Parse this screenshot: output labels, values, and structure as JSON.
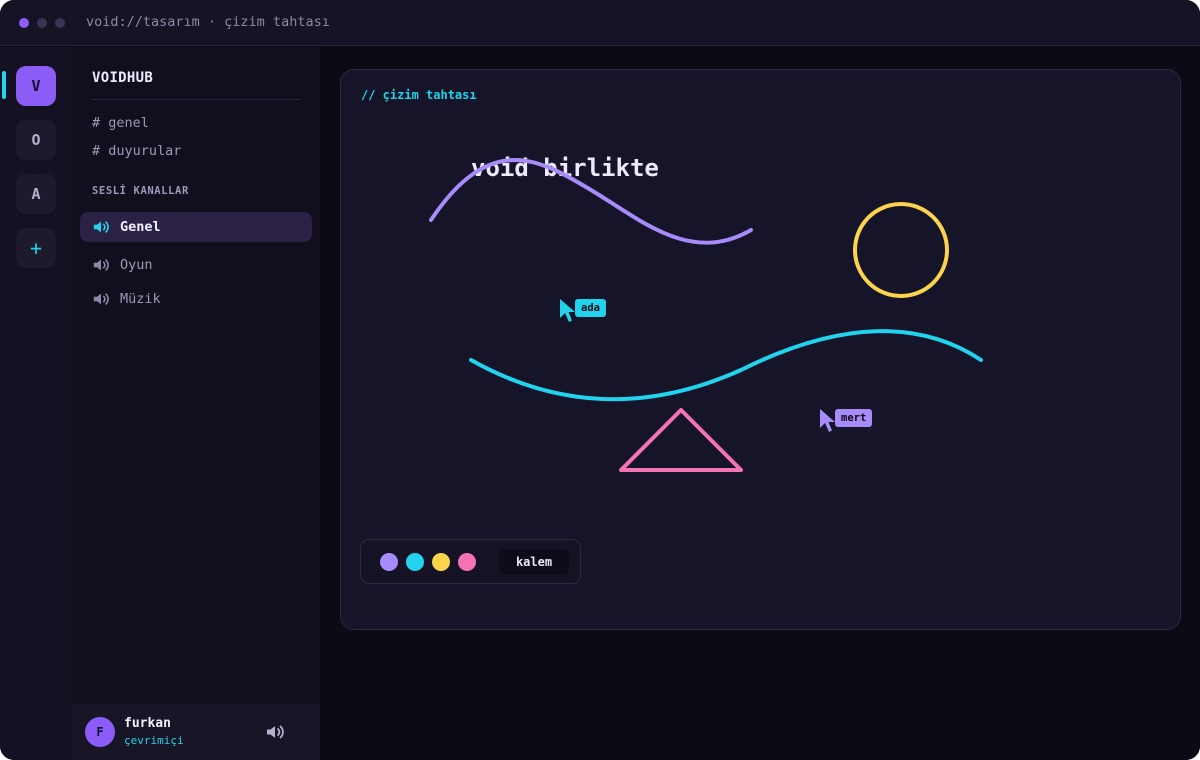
{
  "window": {
    "title": "void://tasarım · çizim tahtası"
  },
  "rail": {
    "servers": [
      {
        "letter": "V",
        "active": true
      },
      {
        "letter": "O",
        "active": false
      },
      {
        "letter": "A",
        "active": false
      }
    ],
    "add_label": "+"
  },
  "sidebar": {
    "server_name": "VOIDHUB",
    "text_channels": [
      "# genel",
      "# duyurular"
    ],
    "voice_section_label": "SESLİ KANALLAR",
    "voice_channels": [
      {
        "label": "Genel",
        "active": true,
        "icon": "speaker-icon"
      },
      {
        "label": "Oyun",
        "active": false,
        "icon": "speaker-icon"
      },
      {
        "label": "Müzik",
        "active": false,
        "icon": "speaker-icon"
      }
    ]
  },
  "user": {
    "initial": "F",
    "name": "furkan",
    "status": "çevrimiçi",
    "icon": "speaker-icon"
  },
  "board": {
    "heading": "// çizim tahtası",
    "canvas_text": "void birlikte",
    "cursors": [
      {
        "name": "ada",
        "color": "#22d3ee"
      },
      {
        "name": "mert",
        "color": "#a78bfa"
      }
    ],
    "palette": {
      "colors": [
        "#a78bfa",
        "#22d3ee",
        "#fcd34d",
        "#f472b6"
      ],
      "tool_label": "kalem"
    }
  },
  "colors": {
    "accent_violet": "#8b5cf6",
    "accent_cyan": "#22d3ee",
    "background": "#0c0a14",
    "stroke_violet": "#a78bfa",
    "stroke_cyan": "#22d3ee",
    "stroke_yellow": "#fcd34d",
    "stroke_pink": "#f472b6"
  }
}
